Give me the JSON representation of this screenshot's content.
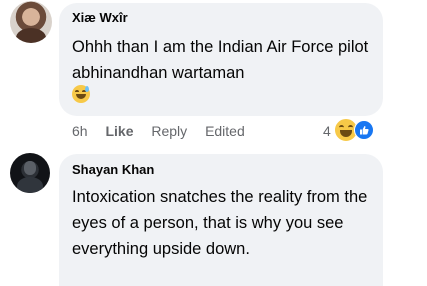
{
  "comments": [
    {
      "author": "Xiæ Wxîr",
      "text": "Ohhh than I am the Indian Air Force pilot abhinandhan wartaman",
      "emoji": "grinning-sweat-emoji",
      "time": "6h",
      "like_label": "Like",
      "reply_label": "Reply",
      "edited_label": "Edited",
      "reaction_count": "4",
      "reactions": [
        "haha-reaction-icon",
        "like-reaction-icon"
      ]
    },
    {
      "author": "Shayan Khan",
      "text": "Intoxication snatches the reality from the eyes of a person, that is why you see everything upside down."
    }
  ],
  "colors": {
    "bubble": "#f0f2f5",
    "meta_text": "#65676b",
    "like_blue": "#1877f2",
    "haha_yellow": "#f7c948"
  }
}
